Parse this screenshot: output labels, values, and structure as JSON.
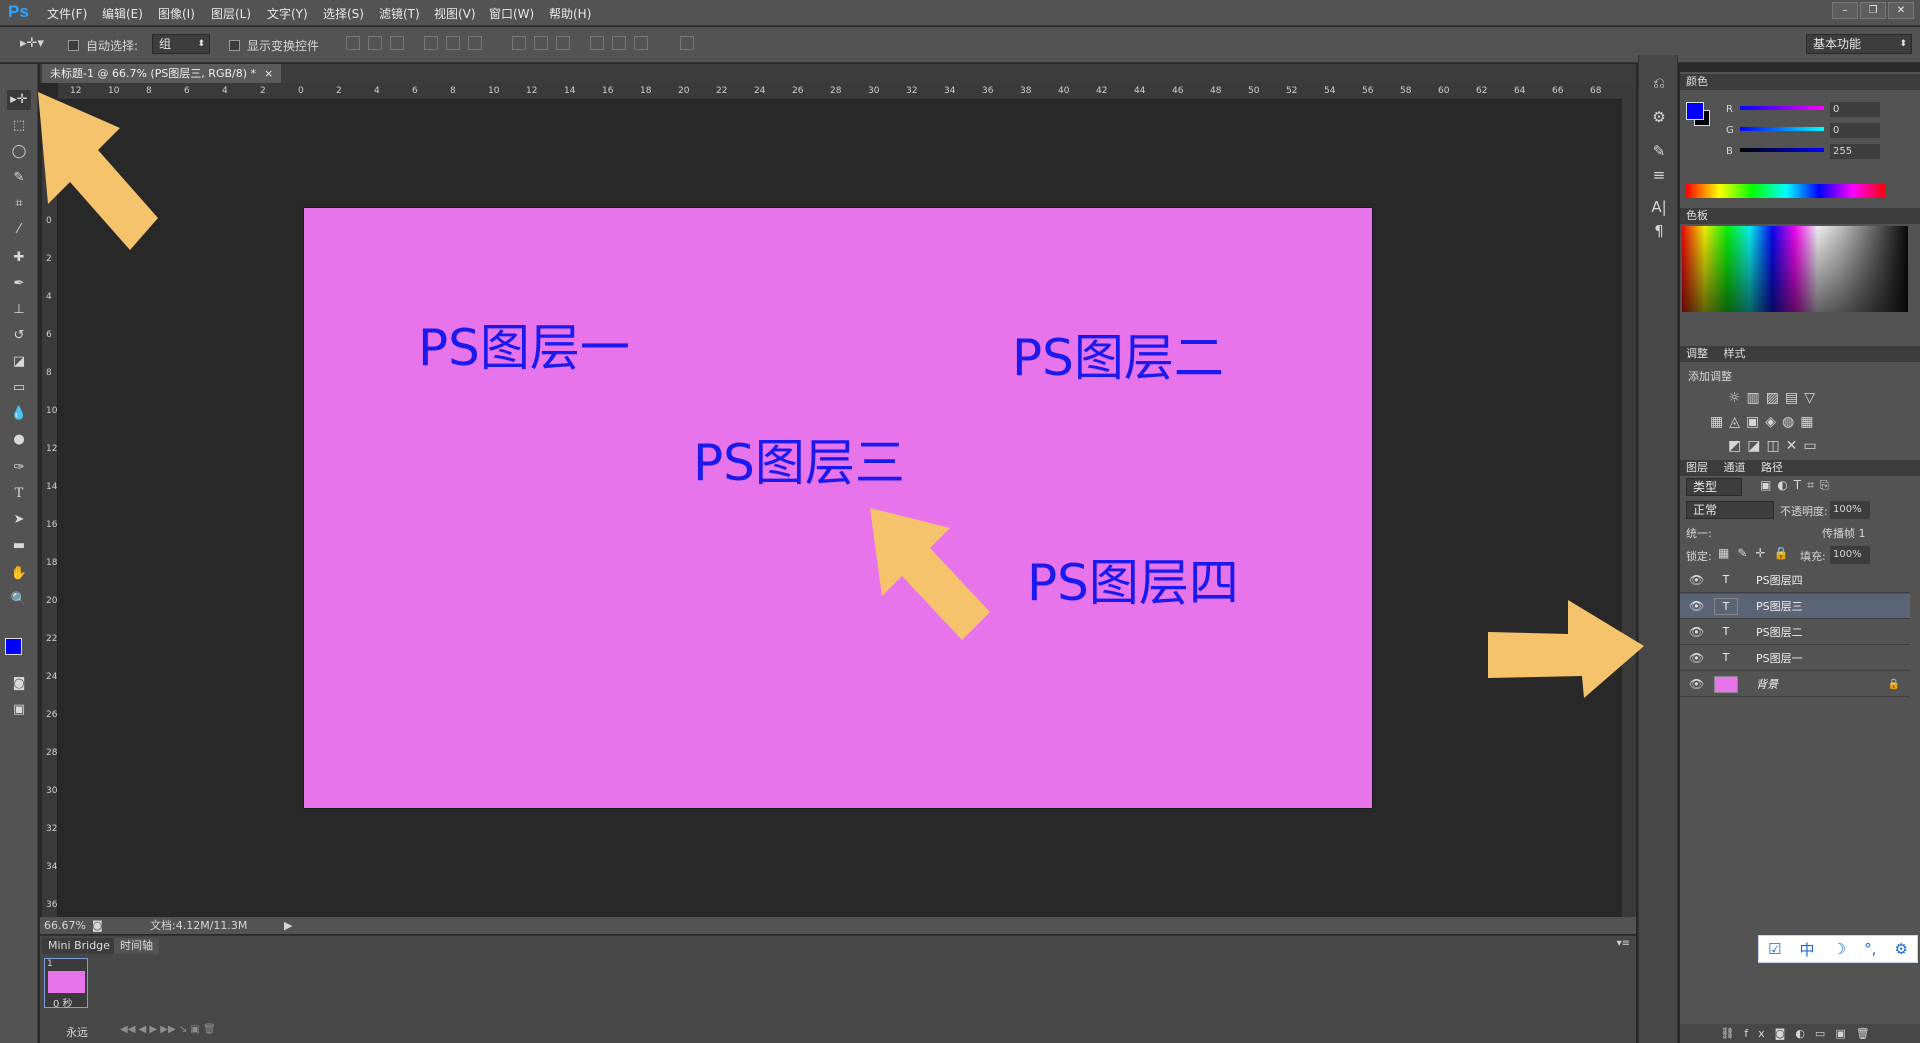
{
  "app": {
    "logo": "Ps"
  },
  "menu": [
    "文件(F)",
    "编辑(E)",
    "图像(I)",
    "图层(L)",
    "文字(Y)",
    "选择(S)",
    "滤镜(T)",
    "视图(V)",
    "窗口(W)",
    "帮助(H)"
  ],
  "window_controls": [
    "–",
    "❐",
    "✕"
  ],
  "options": {
    "auto_select_label": "自动选择:",
    "auto_select_value": "组",
    "show_transform_label": "显示变换控件",
    "workspace": "基本功能"
  },
  "document": {
    "tab_title": "未标题-1 @ 66.7% (PS图层三, RGB/8) *",
    "zoom": "66.67%",
    "doc_size": "文档:4.12M/11.3M"
  },
  "canvas": {
    "background_color": "#e874eb",
    "text_color": "#1a1aee",
    "layers_text": [
      "PS图层一",
      "PS图层二",
      "PS图层三",
      "PS图层四"
    ]
  },
  "ruler": {
    "h": [
      "12",
      "10",
      "8",
      "6",
      "4",
      "2",
      "0",
      "2",
      "4",
      "6",
      "8",
      "10",
      "12",
      "14",
      "16",
      "18",
      "20",
      "22",
      "24",
      "26",
      "28",
      "30",
      "32",
      "34",
      "36",
      "38",
      "40",
      "42",
      "44",
      "46",
      "48",
      "50",
      "52",
      "54",
      "56",
      "58",
      "60",
      "62",
      "64",
      "66",
      "68"
    ],
    "v": [
      "6",
      "4",
      "2",
      "0",
      "2",
      "4",
      "6",
      "8",
      "10",
      "12",
      "14",
      "16",
      "18",
      "20",
      "22",
      "24",
      "26",
      "28",
      "30",
      "32",
      "34",
      "36"
    ]
  },
  "color_panel": {
    "tab": "颜色",
    "r_label": "R",
    "g_label": "G",
    "b_label": "B",
    "r": "0",
    "g": "0",
    "b": "255",
    "foreground": "#0000ff"
  },
  "swatches_panel": {
    "tab": "色板"
  },
  "adjustments_panel": {
    "tabs": [
      "调整",
      "样式"
    ],
    "title": "添加调整"
  },
  "layers_panel": {
    "tabs": [
      "图层",
      "通道",
      "路径"
    ],
    "filter": "类型",
    "blend_mode": "正常",
    "opacity_label": "不透明度:",
    "opacity": "100%",
    "unify_label": "统一:",
    "propagate_label": "传播帧 1",
    "lock_label": "锁定:",
    "fill_label": "填充:",
    "fill": "100%",
    "layers": [
      {
        "name": "PS图层四",
        "kind": "T"
      },
      {
        "name": "PS图层三",
        "kind": "T"
      },
      {
        "name": "PS图层二",
        "kind": "T"
      },
      {
        "name": "PS图层一",
        "kind": "T"
      },
      {
        "name": "背景",
        "kind": "bg"
      }
    ]
  },
  "timeline": {
    "tabs": [
      "Mini Bridge",
      "时间轴"
    ],
    "frame_number": "1",
    "frame_delay": "0 秒",
    "loop": "永远"
  },
  "ime": [
    "中",
    "☽",
    "°,",
    "⚙"
  ],
  "annotation_color": "#f5c36c"
}
